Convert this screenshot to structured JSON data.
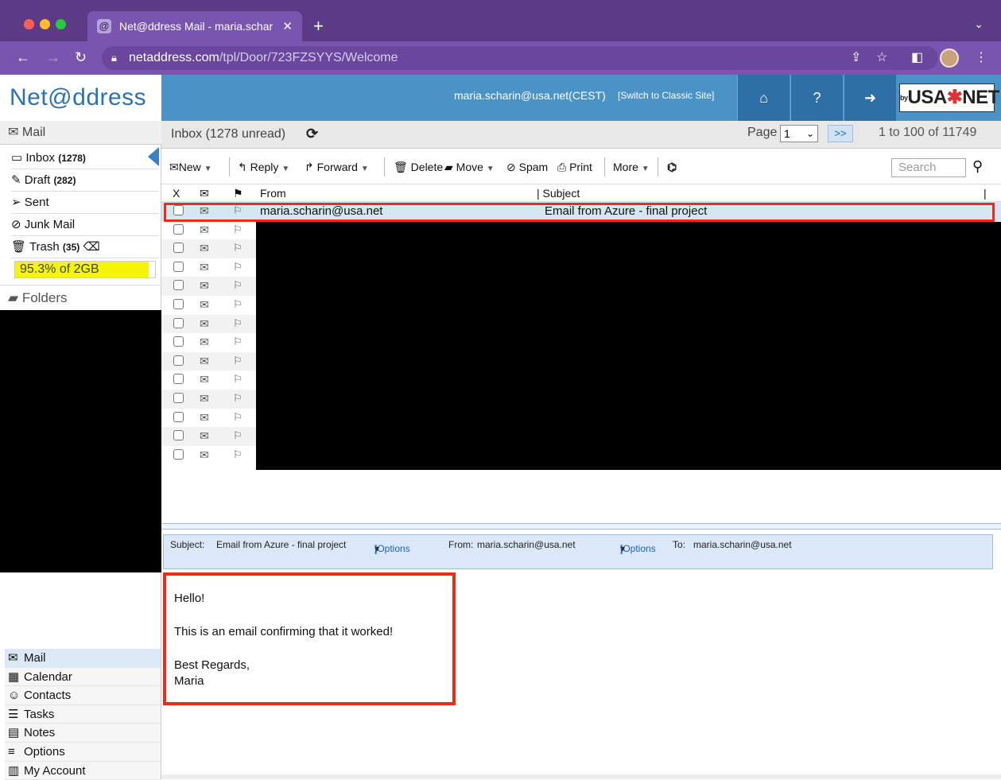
{
  "browser": {
    "tab_title": "Net@ddress Mail - maria.schar",
    "tab_close": "✕",
    "new_tab": "+",
    "url_domain": "netaddress.com",
    "url_path": "/tpl/Door/723FZSYYS/Welcome"
  },
  "header": {
    "logo": "Net@ddress",
    "user_email": "maria.scharin@usa.net(CEST)",
    "switch_site": "[Switch to Classic Site]",
    "brand_by": "by",
    "brand_left": "USA",
    "brand_star": "✱",
    "brand_right": "NET"
  },
  "sidebar": {
    "section": "Mail",
    "items": [
      {
        "label": "Inbox",
        "count": "(1278)"
      },
      {
        "label": "Draft",
        "count": "(282)"
      },
      {
        "label": "Sent",
        "count": ""
      },
      {
        "label": "Junk Mail",
        "count": ""
      },
      {
        "label": "Trash",
        "count": "(35)"
      }
    ],
    "quota_text": "95.3% of 2GB",
    "quota_fraction": 0.953,
    "folders": "Folders",
    "nav": [
      {
        "label": "Mail"
      },
      {
        "label": "Calendar"
      },
      {
        "label": "Contacts"
      },
      {
        "label": "Tasks"
      },
      {
        "label": "Notes"
      },
      {
        "label": "Options"
      },
      {
        "label": "My Account"
      }
    ]
  },
  "inbox": {
    "title": "Inbox (1278 unread)",
    "page_label": "Page",
    "page_value": "1",
    "next": ">>",
    "range": "1 to 100 of 11749"
  },
  "toolbar": {
    "new": "New",
    "reply": "Reply",
    "forward": "Forward",
    "delete": "Delete",
    "move": "Move",
    "spam": "Spam",
    "print": "Print",
    "more": "More",
    "search_placeholder": "Search"
  },
  "columns": {
    "x": "X",
    "from": "From",
    "subject": "| Subject"
  },
  "messages": [
    {
      "from": "maria.scharin@usa.net",
      "subject": "Email from Azure - final project",
      "read": true
    }
  ],
  "preview": {
    "subject_label": "Subject:",
    "subject": "Email from Azure - final project",
    "options": "[Options",
    "options_end": "]",
    "from_label": "From:",
    "from": "maria.scharin@usa.net",
    "to_label": "To:",
    "to": "maria.scharin@usa.net",
    "body": [
      "Hello!",
      "This is an email confirming that it worked!",
      "Best Regards,",
      "Maria"
    ]
  }
}
